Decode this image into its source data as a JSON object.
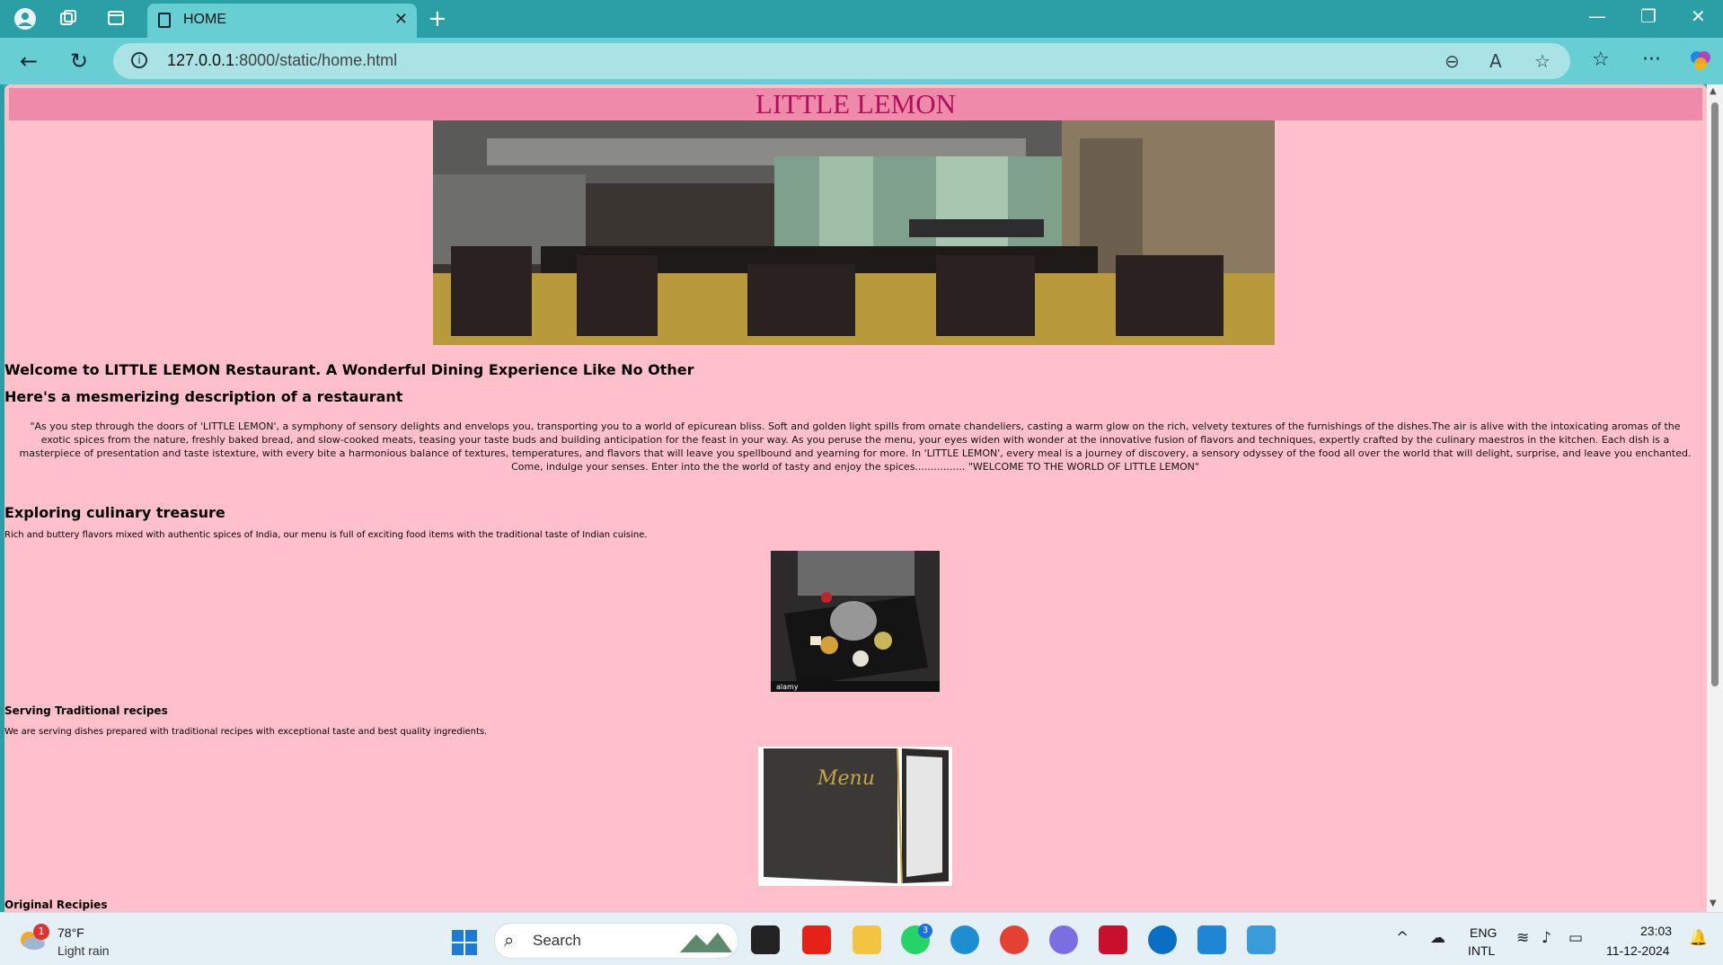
{
  "browser": {
    "tab_title": "HOME",
    "url_host": "127.0.0.1",
    "url_rest": ":8000/static/home.html"
  },
  "page": {
    "site_title": "LITTLE LEMON",
    "welcome_heading": "Welcome to LITTLE LEMON Restaurant. A Wonderful Dining Experience Like No Other",
    "description_heading": "Here's a mesmerizing description of a restaurant",
    "description_paragraph": "\"As you step through the doors of 'LITTLE LEMON', a symphony of sensory delights and envelops you, transporting you to a world of epicurean bliss. Soft and golden light spills from ornate chandeliers, casting a warm glow on the rich, velvety textures of the furnishings of the dishes.The air is alive with the intoxicating aromas of the exotic spices from the nature, freshly baked bread, and slow-cooked meats, teasing your taste buds and building anticipation for the feast in your way. As you peruse the menu, your eyes widen with wonder at the innovative fusion of flavors and techniques, expertly crafted by the culinary maestros in the kitchen. Each dish is a masterpiece of presentation and taste istexture, with every bite a harmonious balance of textures, temperatures, and flavors that will leave you spellbound and yearning for more. In 'LITTLE LEMON', every meal is a journey of discovery, a sensory odyssey of the food all over the world that will delight, surprise, and leave you enchanted. Come, indulge your senses. Enter into the the world of tasty and enjoy the spices................ \"WELCOME TO THE WORLD OF LITTLE LEMON\"",
    "explore_heading": "Exploring culinary treasure",
    "explore_text": "Rich and buttery flavors mixed with authentic spices of India, our menu is full of exciting food items with the traditional taste of Indian cuisine.",
    "serving_heading": "Serving Traditional recipes",
    "serving_text": "We are serving dishes prepared with traditional recipes with exceptional taste and best quality ingredients.",
    "menu_image_text": "Menu",
    "food_image_watermark": "alamy",
    "original_heading": "Original Recipies"
  },
  "taskbar": {
    "weather_badge": "1",
    "temperature": "78°F",
    "condition": "Light rain",
    "search_placeholder": "Search",
    "whatsapp_badge": "3",
    "lang_line1": "ENG",
    "lang_line2": "INTL",
    "time": "23:03",
    "date": "11-12-2024"
  },
  "colors": {
    "browser_chrome": "#2a9fa6",
    "page_background": "#ffc0cb",
    "header_band": "#f08aaa",
    "title_color": "#b0105a"
  }
}
